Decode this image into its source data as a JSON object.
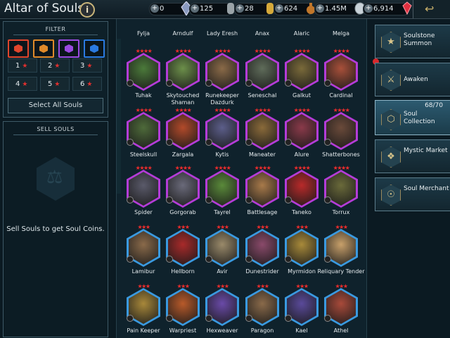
{
  "window": {
    "title": "Altar of Souls",
    "info_label": "i"
  },
  "currencies": [
    {
      "value": "0",
      "icon": "energy-crystal-icon",
      "color": "#9aa9c7"
    },
    {
      "value": "125",
      "icon": "silver-key-icon",
      "color": "#9aa3a8"
    },
    {
      "value": "28",
      "icon": "gold-key-icon",
      "color": "#d5a93a"
    },
    {
      "value": "624",
      "icon": "potion-icon",
      "color": "#c0762a"
    },
    {
      "value": "1.45M",
      "icon": "silver-coin-icon",
      "color": "#c9d2d8"
    },
    {
      "value": "6,914",
      "icon": "gem-icon",
      "color": "#e03040"
    }
  ],
  "filter": {
    "heading": "FILTER",
    "affinities": [
      {
        "icon": "force-affinity-icon",
        "color": "#e0452c"
      },
      {
        "icon": "spirit-affinity-icon",
        "color": "#e08a2a"
      },
      {
        "icon": "void-affinity-icon",
        "color": "#9a4ae0"
      },
      {
        "icon": "magic-affinity-icon",
        "color": "#2a7ae0"
      }
    ],
    "ranks": [
      "1",
      "2",
      "3",
      "4",
      "5",
      "6"
    ],
    "star_glyph": "★",
    "select_all": "Select All Souls"
  },
  "sell": {
    "heading": "SELL SOULS",
    "text": "Sell Souls to get Soul Coins."
  },
  "souls_partial": [
    {
      "name": "Fylja"
    },
    {
      "name": "Arndulf"
    },
    {
      "name": "Lady Eresh"
    },
    {
      "name": "Anax"
    },
    {
      "name": "Alaric"
    },
    {
      "name": "Melga"
    }
  ],
  "souls": [
    {
      "name": "Tuhak",
      "stars": "★★★★",
      "rarity": "epic",
      "color": "#4b7a3a"
    },
    {
      "name": "Skytouched Shaman",
      "stars": "★★★★",
      "rarity": "epic",
      "color": "#6c8f4a"
    },
    {
      "name": "Runekeeper Dazdurk",
      "stars": "★★★★",
      "rarity": "epic",
      "color": "#8a6a48"
    },
    {
      "name": "Seneschal",
      "stars": "★★★★",
      "rarity": "epic",
      "color": "#5f6c5a"
    },
    {
      "name": "Galkut",
      "stars": "★★★★",
      "rarity": "epic",
      "color": "#7a6a3a"
    },
    {
      "name": "Cardinal",
      "stars": "★★★★",
      "rarity": "epic",
      "color": "#a8503a"
    },
    {
      "name": "Steelskull",
      "stars": "★★★★",
      "rarity": "epic",
      "color": "#4e6a3a"
    },
    {
      "name": "Zargala",
      "stars": "★★★★",
      "rarity": "epic",
      "color": "#b24a2a"
    },
    {
      "name": "Kytis",
      "stars": "★★★★",
      "rarity": "epic",
      "color": "#5c5e8a"
    },
    {
      "name": "Maneater",
      "stars": "★★★★",
      "rarity": "epic",
      "color": "#8a6a3a"
    },
    {
      "name": "Alure",
      "stars": "★★★★",
      "rarity": "epic",
      "color": "#8a3a4a"
    },
    {
      "name": "Shatterbones",
      "stars": "★★★★",
      "rarity": "epic",
      "color": "#6a4a3a"
    },
    {
      "name": "Spider",
      "stars": "★★★★",
      "rarity": "epic",
      "color": "#5a5a6a"
    },
    {
      "name": "Gorgorab",
      "stars": "★★★★",
      "rarity": "epic",
      "color": "#6a6a7a"
    },
    {
      "name": "Tayrel",
      "stars": "★★★★",
      "rarity": "epic",
      "color": "#5a8a3a"
    },
    {
      "name": "Battlesage",
      "stars": "★★★★",
      "rarity": "epic",
      "color": "#a87a4a"
    },
    {
      "name": "Taneko",
      "stars": "★★★★",
      "rarity": "epic",
      "color": "#b82a2a"
    },
    {
      "name": "Torrux",
      "stars": "★★★★",
      "rarity": "epic",
      "color": "#6a6a3a"
    },
    {
      "name": "Lamibur",
      "stars": "★★★",
      "rarity": "rare",
      "color": "#8a6a4a"
    },
    {
      "name": "Hellborn",
      "stars": "★★★",
      "rarity": "rare",
      "color": "#a82a2a"
    },
    {
      "name": "Avir",
      "stars": "★★★",
      "rarity": "rare",
      "color": "#9a8a6a"
    },
    {
      "name": "Dunestrider",
      "stars": "★★★",
      "rarity": "rare",
      "color": "#8a4a6a"
    },
    {
      "name": "Myrmidon",
      "stars": "★★★",
      "rarity": "rare",
      "color": "#a88a3a"
    },
    {
      "name": "Reliquary Tender",
      "stars": "★★★",
      "rarity": "rare",
      "color": "#c8a06a"
    },
    {
      "name": "Pain Keeper",
      "stars": "★★★",
      "rarity": "rare",
      "color": "#a8883a"
    },
    {
      "name": "Warpriest",
      "stars": "★★★",
      "rarity": "rare",
      "color": "#b85a2a"
    },
    {
      "name": "Hexweaver",
      "stars": "★★★",
      "rarity": "rare",
      "color": "#6a4aa8"
    },
    {
      "name": "Paragon",
      "stars": "★★★",
      "rarity": "rare",
      "color": "#8a6a4a"
    },
    {
      "name": "Kael",
      "stars": "★★★",
      "rarity": "rare",
      "color": "#5a4a9a"
    },
    {
      "name": "Athel",
      "stars": "★★★",
      "rarity": "rare",
      "color": "#a84a3a"
    }
  ],
  "rarity_colors": {
    "epic": "#b43cd8",
    "rare": "#3a9ae0"
  },
  "side_menu": [
    {
      "label": "Soulstone Summon",
      "icon": "soulstone-icon",
      "glyph": "★"
    },
    {
      "label": "Awaken",
      "icon": "awaken-helmet-icon",
      "glyph": "⚔"
    },
    {
      "label": "Soul Collection",
      "icon": "soul-collection-icon",
      "glyph": "⬡",
      "count": "68/70"
    },
    {
      "label": "Mystic Market",
      "icon": "mystic-market-icon",
      "glyph": "❖"
    },
    {
      "label": "Soul Merchant",
      "icon": "soul-merchant-icon",
      "glyph": "☉"
    }
  ]
}
